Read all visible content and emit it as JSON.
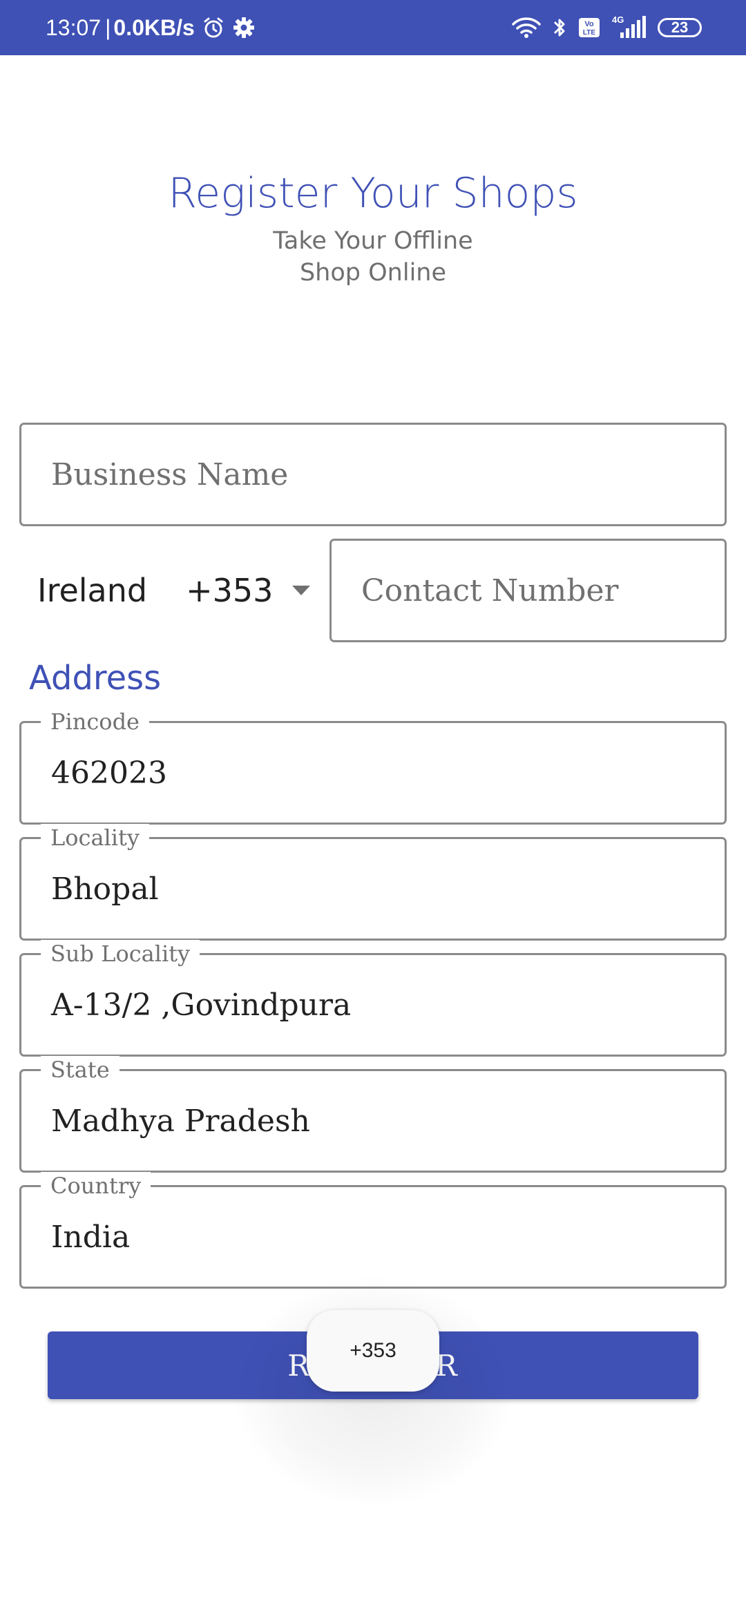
{
  "status_bar": {
    "time": "13:07",
    "separator": "|",
    "network_speed": "0.0KB/s",
    "battery_level": "23",
    "network_type": "4G",
    "icons": [
      "alarm-icon",
      "settings-icon",
      "wifi-icon",
      "bluetooth-icon",
      "volte-icon",
      "signal-icon",
      "battery-icon"
    ],
    "background_color": "#3f51b5"
  },
  "header": {
    "title": "Register Your Shops",
    "subtitle_line1": "Take Your Offline",
    "subtitle_line2": "Shop Online"
  },
  "form": {
    "business_name": {
      "placeholder": "Business Name",
      "value": ""
    },
    "phone": {
      "country": "Ireland",
      "dial_code": "+353",
      "placeholder": "Contact Number",
      "value": ""
    },
    "address_heading": "Address",
    "address_fields": [
      {
        "label": "Pincode",
        "value": "462023"
      },
      {
        "label": "Locality",
        "value": "Bhopal"
      },
      {
        "label": "Sub Locality",
        "value": "A-13/2 ,Govindpura"
      },
      {
        "label": "State",
        "value": "Madhya Pradesh"
      },
      {
        "label": "Country",
        "value": "India"
      }
    ],
    "register_label": "REGISTER"
  },
  "toast": {
    "text": "+353"
  },
  "colors": {
    "primary": "#3f51b5",
    "border": "#8a8a8a",
    "hint_text": "#707070"
  }
}
